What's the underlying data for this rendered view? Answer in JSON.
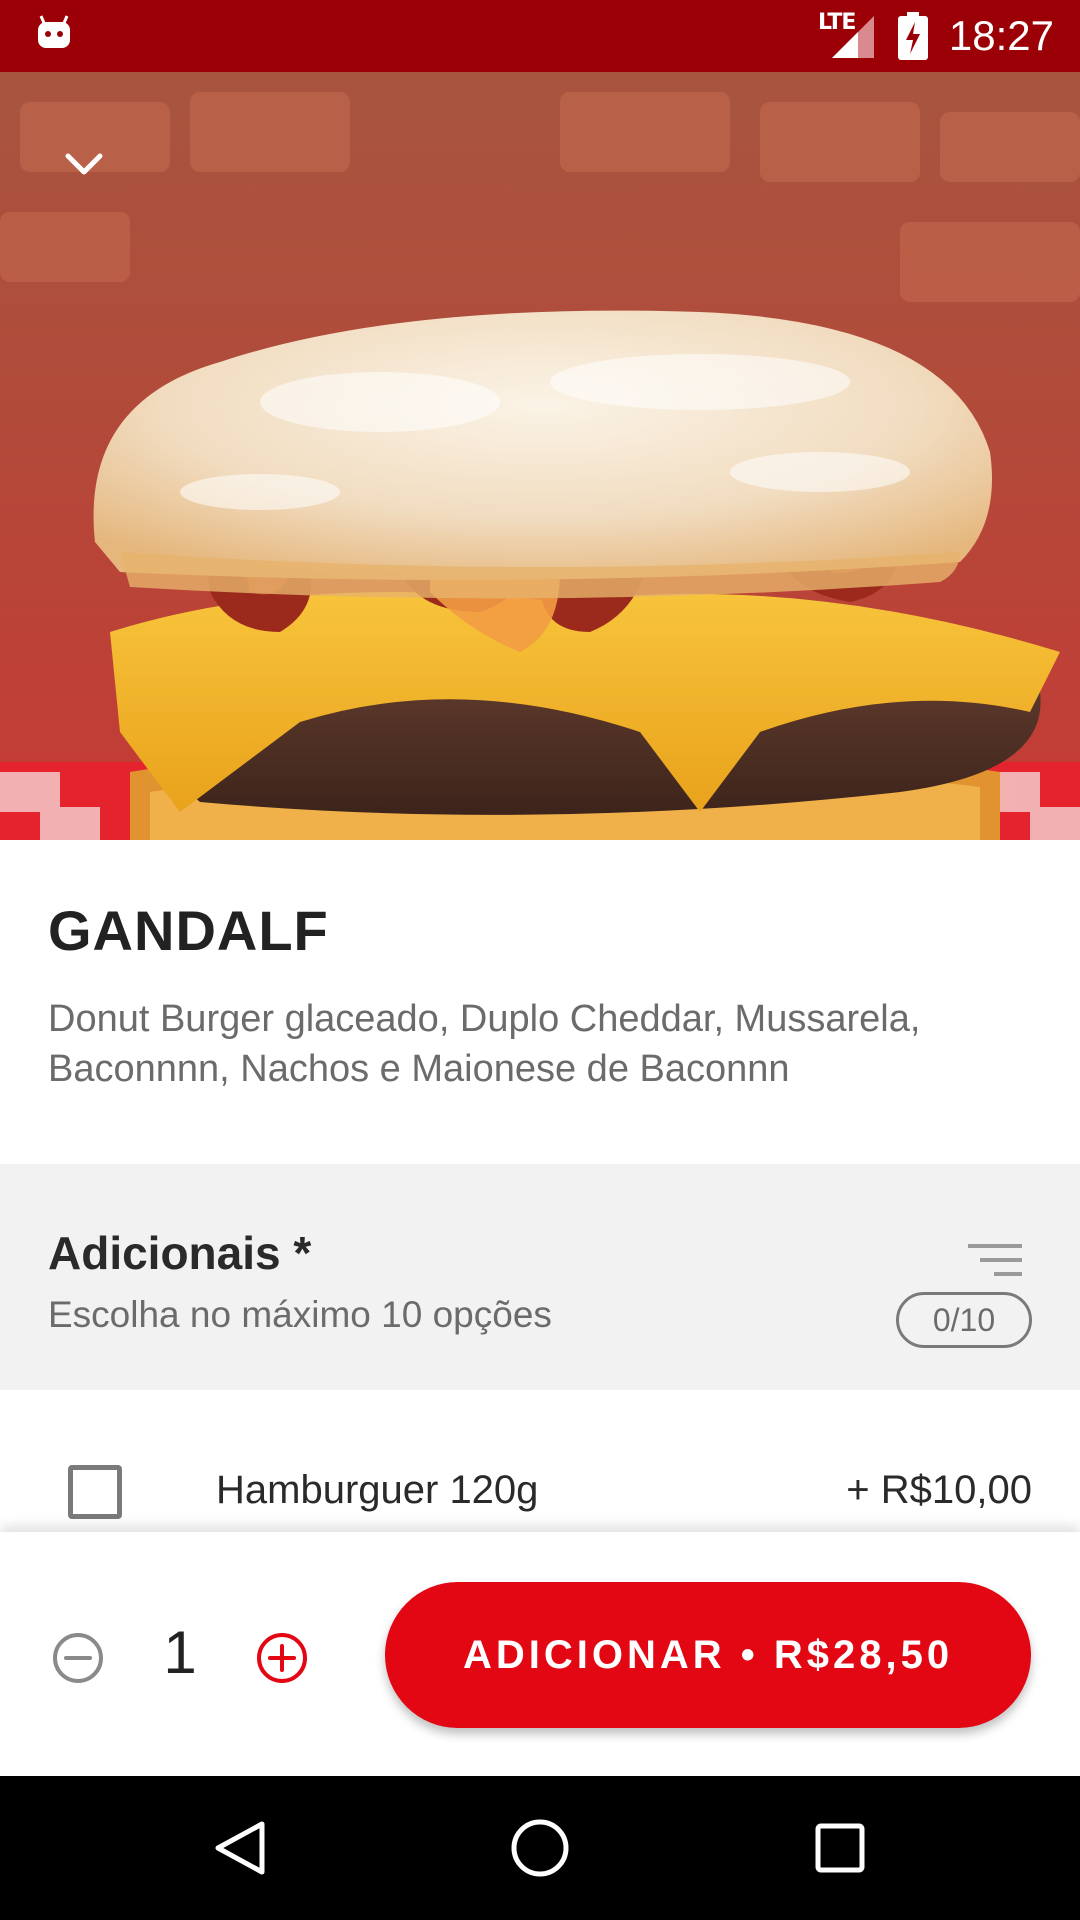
{
  "status_bar": {
    "network": "LTE",
    "time": "18:27"
  },
  "hero": {
    "image_alt": "burger-photo"
  },
  "product": {
    "title": "GANDALF",
    "description": "Donut Burger glaceado, Duplo Cheddar, Mussarela, Baconnnn, Nachos e Maionese de Baconnn"
  },
  "section": {
    "title": "Adicionais *",
    "subtitle": "Escolha no máximo 10 opções",
    "count": "0/10"
  },
  "options": [
    {
      "label": "Hamburguer 120g",
      "price": "+ R$10,00",
      "checked": false
    }
  ],
  "action_bar": {
    "quantity": "1",
    "add_label": "ADICIONAR • R$28,50"
  },
  "colors": {
    "status_bar": "#9b0007",
    "accent": "#e30613",
    "section_bg": "#f2f2f2",
    "text_primary": "#222222",
    "text_secondary": "#6b6b6b"
  },
  "icons": {
    "back": "chevron-down-icon",
    "filter": "filter-icon",
    "minus": "minus-circle-icon",
    "plus": "plus-circle-icon",
    "nav_back": "triangle-back-icon",
    "nav_home": "circle-home-icon",
    "nav_recents": "square-recents-icon"
  }
}
